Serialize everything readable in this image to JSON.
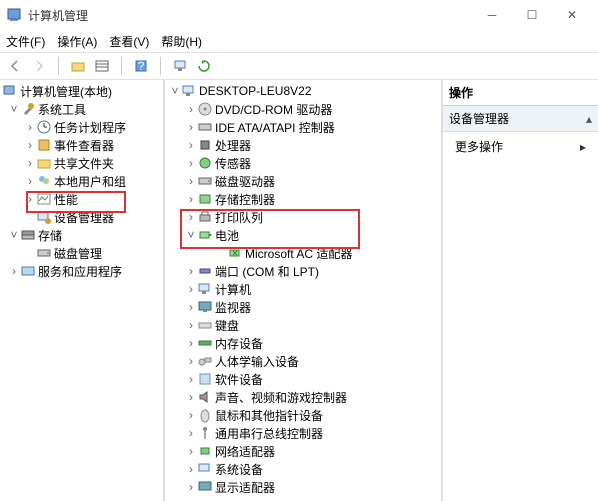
{
  "window": {
    "title": "计算机管理"
  },
  "menu": {
    "file": "文件(F)",
    "action": "操作(A)",
    "view": "查看(V)",
    "help": "帮助(H)"
  },
  "left_tree": {
    "root": "计算机管理(本地)",
    "system_tools": "系统工具",
    "task_scheduler": "任务计划程序",
    "event_viewer": "事件查看器",
    "shared_folders": "共享文件夹",
    "local_users": "本地用户和组",
    "performance": "性能",
    "device_manager": "设备管理器",
    "storage": "存储",
    "disk_mgmt": "磁盘管理",
    "services_apps": "服务和应用程序"
  },
  "center_tree": {
    "root": "DESKTOP-LEU8V22",
    "items": [
      "DVD/CD-ROM 驱动器",
      "IDE ATA/ATAPI 控制器",
      "处理器",
      "传感器",
      "磁盘驱动器",
      "存储控制器",
      "打印队列",
      "电池",
      "Microsoft AC 适配器",
      "端口 (COM 和 LPT)",
      "计算机",
      "监视器",
      "键盘",
      "内存设备",
      "人体学输入设备",
      "软件设备",
      "声音、视频和游戏控制器",
      "鼠标和其他指针设备",
      "通用串行总线控制器",
      "网络适配器",
      "系统设备",
      "显示适配器"
    ]
  },
  "right_pane": {
    "header": "操作",
    "subheader": "设备管理器",
    "more": "更多操作"
  }
}
